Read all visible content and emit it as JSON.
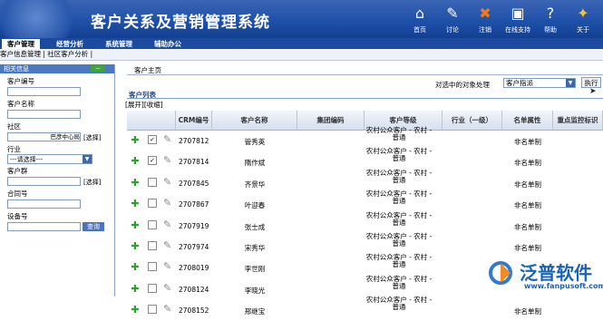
{
  "header": {
    "app_title": "客户关系及营销管理系统",
    "icons": [
      {
        "name": "home-icon",
        "label": "首页",
        "glyph": "⌂"
      },
      {
        "name": "discussion-icon",
        "label": "讨论",
        "glyph": "✎"
      },
      {
        "name": "logout-icon",
        "label": "注销",
        "glyph": "✖"
      },
      {
        "name": "online-support-icon",
        "label": "在线支持",
        "glyph": "▣"
      },
      {
        "name": "help-icon",
        "label": "帮助",
        "glyph": "?"
      },
      {
        "name": "about-icon",
        "label": "关于",
        "glyph": "✦"
      }
    ]
  },
  "menu": {
    "tabs": [
      "客户管理",
      "经营分析",
      "系统管理",
      "辅助办公"
    ],
    "active_tab": "客户管理"
  },
  "submenu": {
    "items": [
      "客户信息管理",
      "社区客户分析"
    ]
  },
  "left_panel": {
    "title": "相关信息",
    "toggle_label": "—",
    "customer_no_label": "客户编号",
    "customer_name_label": "客户名称",
    "community_label": "社区",
    "community_value": "巴彦中心局",
    "select_link": "[选择]",
    "industry_label": "行业",
    "industry_value": "---请选择---",
    "customer_group_label": "客户群",
    "contract_no_label": "合同号",
    "device_no_label": "设备号",
    "query_button": "查询"
  },
  "main": {
    "breadcrumb": "客户主页",
    "filter_label": "对选中的对象处理",
    "filter_value": "客户指派",
    "execute_button": "执行",
    "list_title": "客户列表",
    "expand_link": "[展开]",
    "collapse_link": "[收缩]",
    "columns": [
      "CRM编号",
      "客户名称",
      "集团编码",
      "客户等级",
      "行业（一级）",
      "名单属性",
      "重点监控标识"
    ],
    "rows": [
      {
        "crm_id": "2707812",
        "name": "管秀英",
        "grade": [
          "农村公众客户 - 农村 -",
          "普通"
        ],
        "list_attr": "非名单制",
        "checked": true
      },
      {
        "crm_id": "2707814",
        "name": "隋作斌",
        "grade": [
          "农村公众客户 - 农村 -",
          "普通"
        ],
        "list_attr": "非名单制",
        "checked": true
      },
      {
        "crm_id": "2707845",
        "name": "齐景华",
        "grade": [
          "农村公众客户 - 农村 -",
          "普通"
        ],
        "list_attr": "非名单制",
        "checked": false
      },
      {
        "crm_id": "2707867",
        "name": "叶迎春",
        "grade": [
          "农村公众客户 - 农村 -",
          "普通"
        ],
        "list_attr": "非名单制",
        "checked": false
      },
      {
        "crm_id": "2707919",
        "name": "张士成",
        "grade": [
          "农村公众客户 - 农村 -",
          "普通"
        ],
        "list_attr": "非名单制",
        "checked": false
      },
      {
        "crm_id": "2707974",
        "name": "宋秀华",
        "grade": [
          "农村公众客户 - 农村 -",
          "普通"
        ],
        "list_attr": "非名单制",
        "checked": false
      },
      {
        "crm_id": "2708019",
        "name": "李世刚",
        "grade": [
          "农村公众客户 - 农村 -",
          "普通"
        ],
        "list_attr": "非名单制",
        "checked": false
      },
      {
        "crm_id": "2708124",
        "name": "李晓光",
        "grade": [
          "农村公众客户 - 农村 -",
          "普通"
        ],
        "list_attr": "非名单制",
        "checked": false
      },
      {
        "crm_id": "2708152",
        "name": "邢继宝",
        "grade": [
          "农村公众客户 - 农村 -",
          "普通"
        ],
        "list_attr": "非名单制",
        "checked": false
      }
    ]
  },
  "watermark": {
    "name": "泛普软件",
    "url": "www.fanpusoft.com"
  }
}
